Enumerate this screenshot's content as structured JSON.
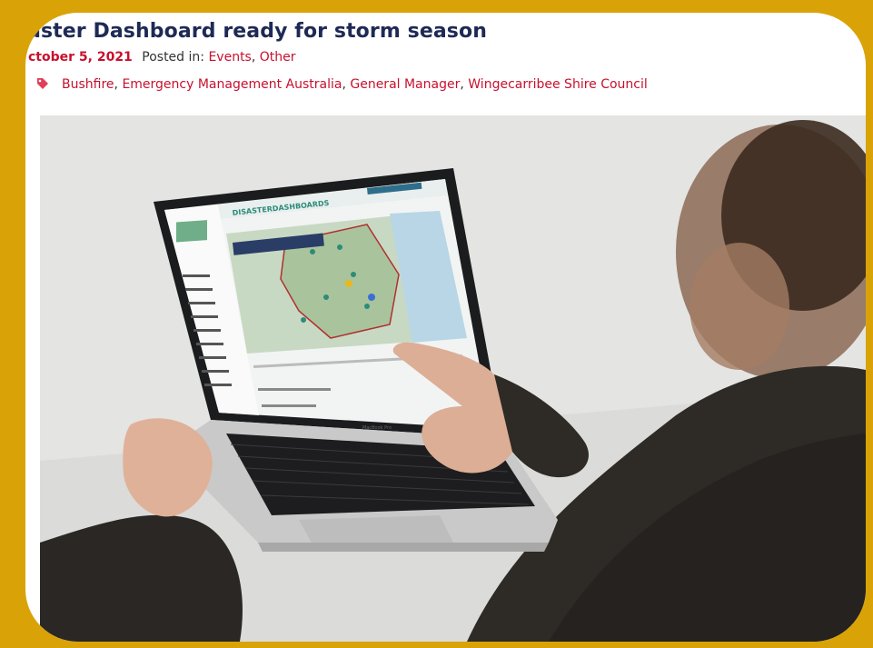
{
  "post": {
    "title": "aster Dashboard ready for storm season",
    "date": "ctober 5, 2021",
    "posted_in_label": "Posted in:",
    "categories": [
      "Events",
      "Other"
    ],
    "tags": [
      "Bushfire",
      "Emergency Management Australia",
      "General Manager",
      "Wingecarribee Shire Council"
    ]
  },
  "photo": {
    "screen_brand": "DISASTERDASHBOARDS",
    "keyboard_label": "MacBook Pro"
  },
  "colors": {
    "frame": "#d9a307",
    "title": "#1e2a55",
    "link": "#c8102e",
    "brand_teal": "#2e8b7a"
  }
}
